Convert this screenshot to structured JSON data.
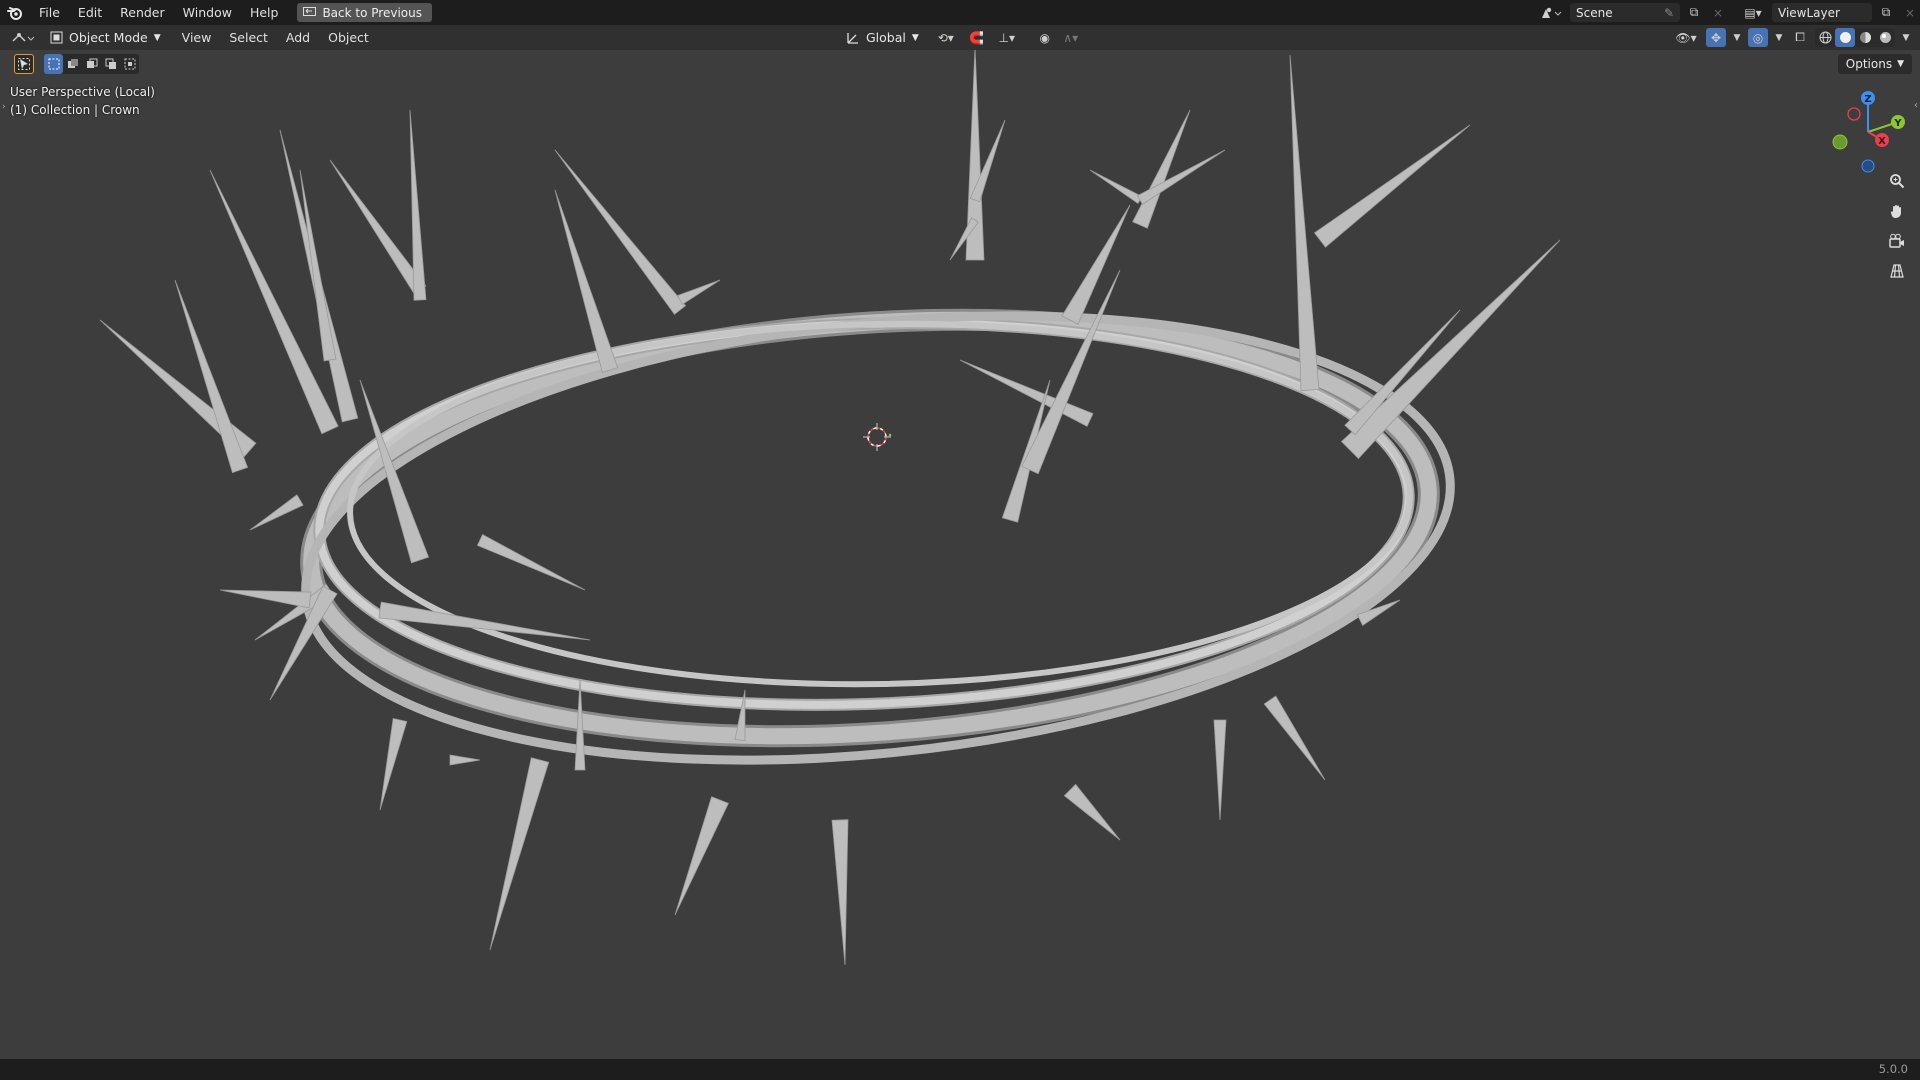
{
  "menubar": {
    "items": [
      "File",
      "Edit",
      "Render",
      "Window",
      "Help"
    ],
    "back_button": "Back to Previous",
    "scene": "Scene",
    "view_layer": "ViewLayer"
  },
  "viewport_header": {
    "mode": "Object Mode",
    "menus": [
      "View",
      "Select",
      "Add",
      "Object"
    ],
    "transform_orientation": "Global"
  },
  "tool_header": {
    "options_label": "Options"
  },
  "overlay": {
    "view_name": "User Perspective (Local)",
    "collection_info": "(1) Collection | Crown"
  },
  "gizmo": {
    "axes": {
      "z": "Z",
      "y": "Y",
      "x": "X"
    },
    "colors": {
      "x": "#e8404f",
      "y": "#8bc638",
      "z": "#3f8ef0"
    }
  },
  "status": {
    "version": "5.0.0"
  },
  "colors": {
    "accent": "#4772b3",
    "viewport_bg": "#3d3d3d",
    "crown": "#bdbdbd",
    "active_tool_border": "#e09e2e"
  }
}
